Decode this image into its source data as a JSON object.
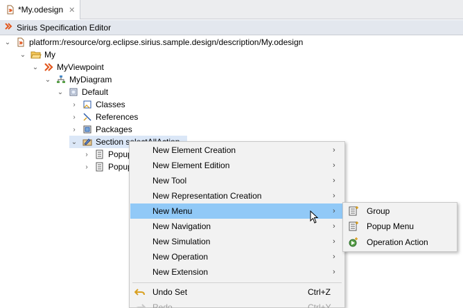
{
  "editor": {
    "tab_title": "*My.odesign",
    "header_title": "Sirius Specification Editor"
  },
  "tree": [
    {
      "label": "platform:/resource/org.eclipse.sirius.sample.design/description/My.odesign",
      "icon": "odesign-file-icon",
      "expanded": true
    },
    {
      "label": "My",
      "icon": "folder-icon",
      "expanded": true
    },
    {
      "label": "MyViewpoint",
      "icon": "viewpoint-icon",
      "expanded": true
    },
    {
      "label": "MyDiagram",
      "icon": "diagram-icon",
      "expanded": true
    },
    {
      "label": "Default",
      "icon": "layer-icon",
      "expanded": true
    },
    {
      "label": "Classes",
      "icon": "container-mapping-icon",
      "expanded": false
    },
    {
      "label": "References",
      "icon": "edge-mapping-icon",
      "expanded": false
    },
    {
      "label": "Packages",
      "icon": "node-mapping-icon",
      "expanded": false
    },
    {
      "label": "Section selectAllAction",
      "icon": "tool-section-icon",
      "expanded": true,
      "selected": true
    },
    {
      "label": "Popup Menu",
      "icon": "popup-menu-icon",
      "expanded": false
    },
    {
      "label": "Popup Menu",
      "icon": "popup-menu-icon",
      "expanded": false
    }
  ],
  "context_menu": {
    "items": [
      {
        "label": "New Element Creation",
        "submenu": true
      },
      {
        "label": "New Element Edition",
        "submenu": true
      },
      {
        "label": "New Tool",
        "submenu": true
      },
      {
        "label": "New Representation Creation",
        "submenu": true
      },
      {
        "label": "New Menu",
        "submenu": true,
        "highlighted": true
      },
      {
        "label": "New Navigation",
        "submenu": true
      },
      {
        "label": "New Simulation",
        "submenu": true
      },
      {
        "label": "New Operation",
        "submenu": true
      },
      {
        "label": "New Extension",
        "submenu": true
      }
    ],
    "undo": {
      "label": "Undo Set",
      "accel": "Ctrl+Z",
      "icon": "undo-icon"
    },
    "redo": {
      "label": "Redo",
      "accel": "Ctrl+Y",
      "icon": "redo-icon",
      "disabled": true
    }
  },
  "submenu": {
    "items": [
      {
        "label": "Group",
        "icon": "group-icon"
      },
      {
        "label": "Popup Menu",
        "icon": "popup-menu-icon"
      },
      {
        "label": "Operation Action",
        "icon": "operation-action-icon"
      }
    ]
  },
  "colors": {
    "menu_highlight": "#91c9f7",
    "tree_selection": "#dbe7f7",
    "header_bg": "#e3e7ee"
  }
}
